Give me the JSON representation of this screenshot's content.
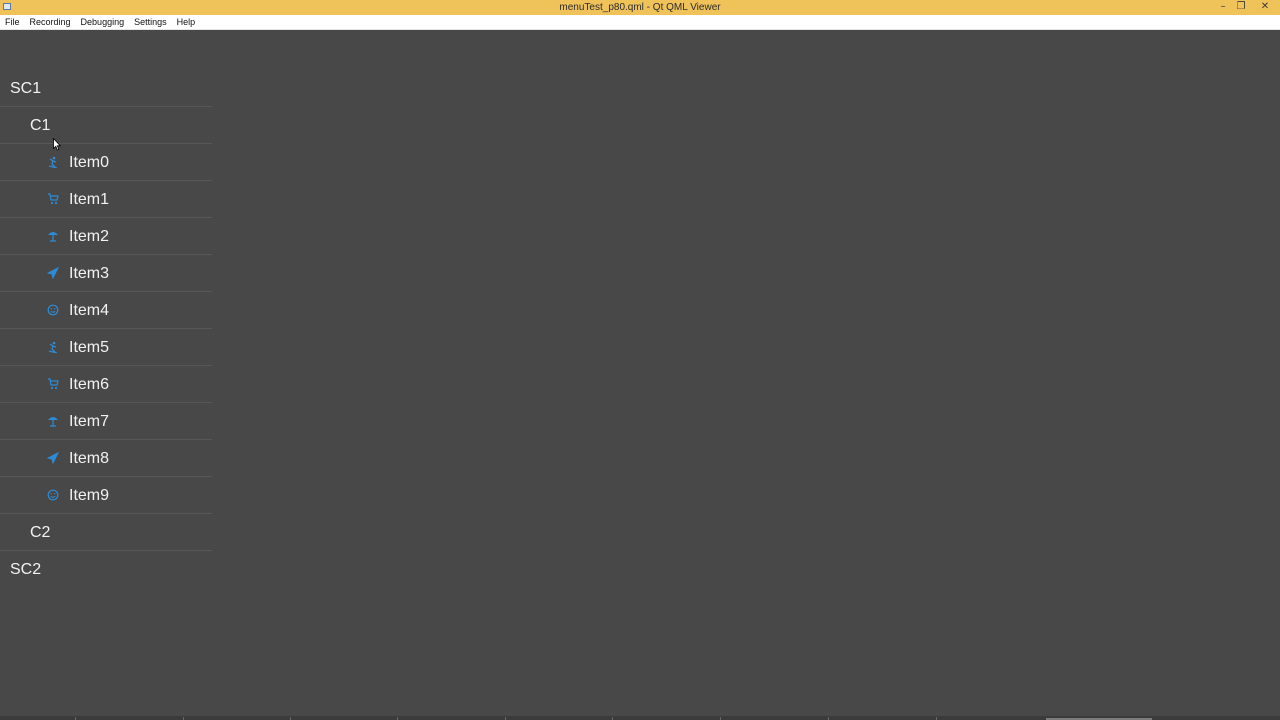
{
  "window": {
    "title": "menuTest_p80.qml - Qt QML Viewer",
    "controls": {
      "minimize": "–",
      "restore": "❐",
      "close": "✕"
    }
  },
  "menubar": {
    "items": [
      "File",
      "Recording",
      "Debugging",
      "Settings",
      "Help"
    ]
  },
  "tree": {
    "rows": [
      {
        "label": "SC1",
        "level": 0
      },
      {
        "label": "C1",
        "level": 1
      },
      {
        "label": "Item0",
        "level": 2,
        "icon": "skier-icon"
      },
      {
        "label": "Item1",
        "level": 2,
        "icon": "shopping-cart-icon"
      },
      {
        "label": "Item2",
        "level": 2,
        "icon": "beach-umbrella-icon"
      },
      {
        "label": "Item3",
        "level": 2,
        "icon": "airplane-icon"
      },
      {
        "label": "Item4",
        "level": 2,
        "icon": "smiley-icon"
      },
      {
        "label": "Item5",
        "level": 2,
        "icon": "skier-icon"
      },
      {
        "label": "Item6",
        "level": 2,
        "icon": "shopping-cart-icon"
      },
      {
        "label": "Item7",
        "level": 2,
        "icon": "beach-umbrella-icon"
      },
      {
        "label": "Item8",
        "level": 2,
        "icon": "airplane-icon"
      },
      {
        "label": "Item9",
        "level": 2,
        "icon": "smiley-icon"
      },
      {
        "label": "C2",
        "level": 1
      },
      {
        "label": "SC2",
        "level": 0
      }
    ]
  },
  "colors": {
    "titlebar": "#f0c25a",
    "background": "#484848",
    "text": "#f2f2f2",
    "icon": "#2e8bd6",
    "separator": "#585858"
  }
}
